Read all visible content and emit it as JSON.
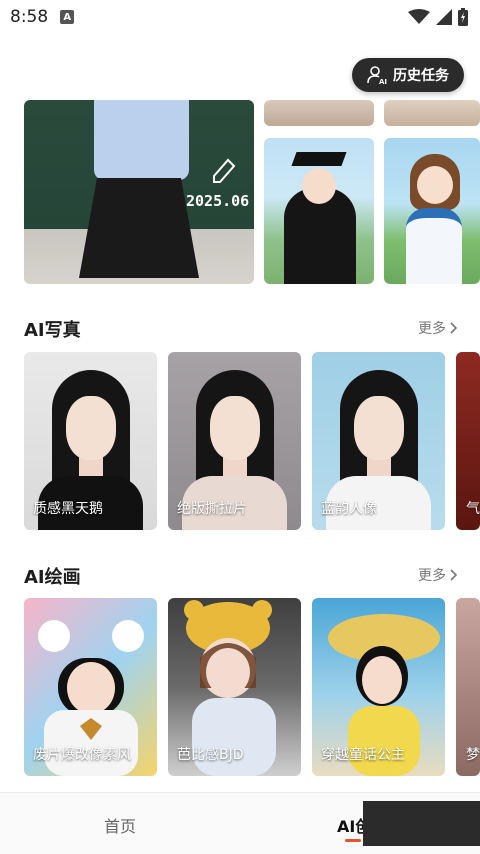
{
  "status_bar": {
    "time": "8:58"
  },
  "history_button": {
    "label": "历史任务",
    "icon": "user-ai-icon"
  },
  "banner": {
    "year_text": "2025.06"
  },
  "sections": [
    {
      "title": "AI写真",
      "more_label": "更多",
      "cards": [
        {
          "label": "质感黑天鹅"
        },
        {
          "label": "绝版撕拉片"
        },
        {
          "label": "蓝韵人像"
        },
        {
          "label": "气"
        }
      ]
    },
    {
      "title": "AI绘画",
      "more_label": "更多",
      "cards": [
        {
          "label": "废片爆改像素风"
        },
        {
          "label": "芭比感BJD"
        },
        {
          "label": "穿越童话公主"
        },
        {
          "label": "梦"
        }
      ]
    }
  ],
  "bottom_nav": {
    "tabs": [
      {
        "label": "首页",
        "active": false
      },
      {
        "label": "AI创",
        "active": true
      }
    ],
    "accent": "#e8532b"
  }
}
